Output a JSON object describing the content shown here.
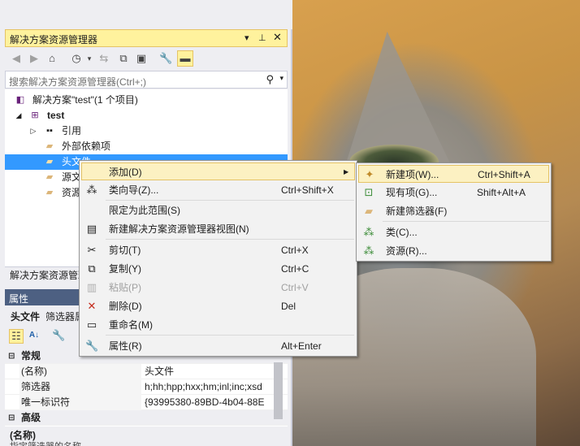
{
  "solution_explorer": {
    "title": "解决方案资源管理器",
    "search_placeholder": "搜索解决方案资源管理器(Ctrl+;)",
    "tree": {
      "solution": "解决方案\"test\"(1 个项目)",
      "project": "test",
      "references": "引用",
      "external_deps": "外部依赖项",
      "header_files": "头文件",
      "source_files": "源文件",
      "resource_files": "资源文件"
    },
    "bottom_tab": "解决方案资源管理器"
  },
  "properties": {
    "title": "属性",
    "object_label": "头文件",
    "object_type": "筛选器属性",
    "category_general": "常规",
    "rows": [
      {
        "name": "(名称)",
        "value": "头文件"
      },
      {
        "name": "筛选器",
        "value": "h;hh;hpp;hxx;hm;inl;inc;xsd"
      },
      {
        "name": "唯一标识符",
        "value": "{93995380-89BD-4b04-88E"
      }
    ],
    "category_advanced": "高级",
    "desc_title": "(名称)",
    "desc_text": "指定筛选器的名称"
  },
  "context_menu": {
    "items": [
      {
        "label": "添加(D)",
        "shortcut": ""
      },
      {
        "label": "类向导(Z)...",
        "shortcut": "Ctrl+Shift+X"
      },
      {
        "label": "限定为此范围(S)",
        "shortcut": ""
      },
      {
        "label": "新建解决方案资源管理器视图(N)",
        "shortcut": ""
      },
      {
        "label": "剪切(T)",
        "shortcut": "Ctrl+X"
      },
      {
        "label": "复制(Y)",
        "shortcut": "Ctrl+C"
      },
      {
        "label": "粘贴(P)",
        "shortcut": "Ctrl+V"
      },
      {
        "label": "删除(D)",
        "shortcut": "Del"
      },
      {
        "label": "重命名(M)",
        "shortcut": ""
      },
      {
        "label": "属性(R)",
        "shortcut": "Alt+Enter"
      }
    ]
  },
  "submenu": {
    "items": [
      {
        "label": "新建项(W)...",
        "shortcut": "Ctrl+Shift+A"
      },
      {
        "label": "现有项(G)...",
        "shortcut": "Shift+Alt+A"
      },
      {
        "label": "新建筛选器(F)",
        "shortcut": ""
      },
      {
        "label": "类(C)...",
        "shortcut": ""
      },
      {
        "label": "资源(R)...",
        "shortcut": ""
      }
    ]
  },
  "colors": {
    "selection": "#3399ff",
    "titlebar_active": "#fff29d",
    "menu_highlight": "#fcf1c2",
    "delete_icon": "#c42b1c"
  }
}
